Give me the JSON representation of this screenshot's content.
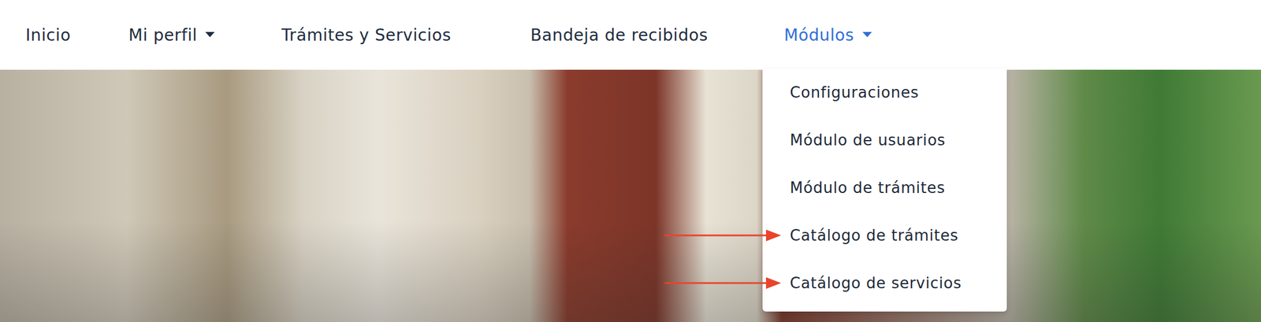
{
  "nav": {
    "items": [
      {
        "label": "Inicio",
        "has_dropdown": false,
        "expanded": false
      },
      {
        "label": "Mi perfil",
        "has_dropdown": true,
        "expanded": false
      },
      {
        "label": "Trámites y Servicios",
        "has_dropdown": false,
        "expanded": false
      },
      {
        "label": "Bandeja de recibidos",
        "has_dropdown": false,
        "expanded": false
      },
      {
        "label": "Módulos",
        "has_dropdown": true,
        "expanded": true
      }
    ]
  },
  "dropdown": {
    "items": [
      {
        "label": "Configuraciones",
        "marked": false
      },
      {
        "label": "Módulo de usuarios",
        "marked": false
      },
      {
        "label": "Módulo de trámites",
        "marked": false
      },
      {
        "label": "Catálogo de trámites",
        "marked": true
      },
      {
        "label": "Catálogo de servicios",
        "marked": true
      }
    ]
  }
}
